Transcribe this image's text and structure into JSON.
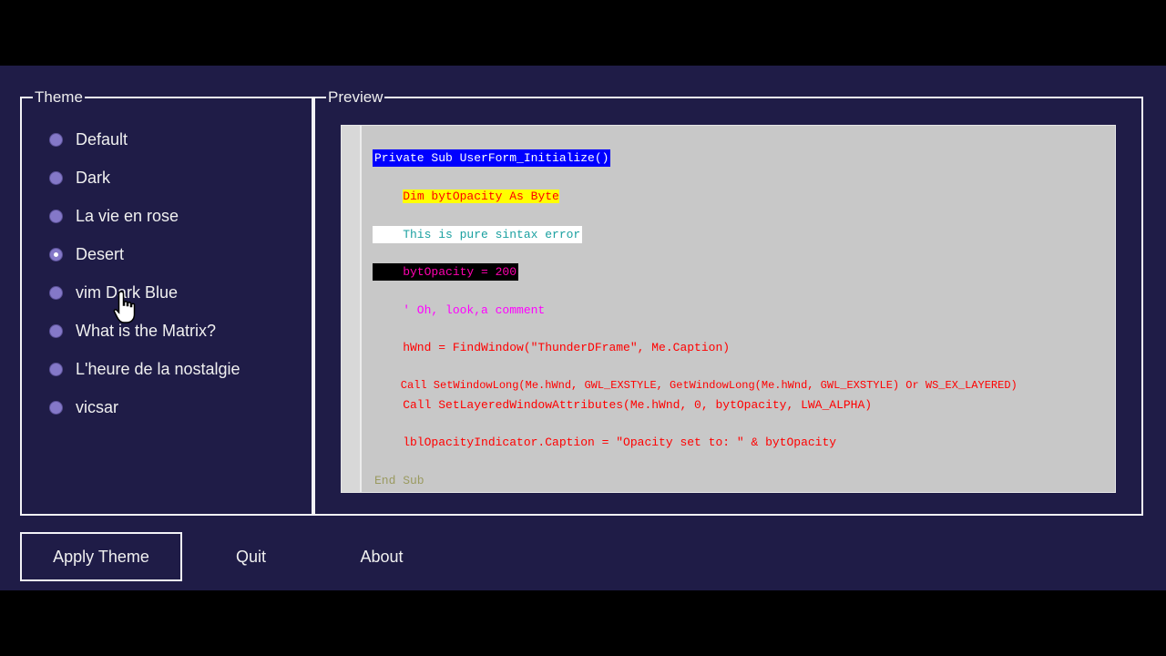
{
  "theme_group": {
    "legend": "Theme",
    "options": [
      {
        "label": "Default",
        "checked": false
      },
      {
        "label": "Dark",
        "checked": false
      },
      {
        "label": "La vie en rose",
        "checked": false
      },
      {
        "label": "Desert",
        "checked": true
      },
      {
        "label": "vim Dark Blue",
        "checked": false
      },
      {
        "label": "What is the Matrix?",
        "checked": false
      },
      {
        "label": "L'heure de la nostalgie",
        "checked": false
      },
      {
        "label": "vicsar",
        "checked": false
      }
    ]
  },
  "preview_group": {
    "legend": "Preview",
    "code_lines": [
      {
        "text": "Private Sub UserForm_Initialize()",
        "color": "#ffffff",
        "bg": "#0000ff"
      },
      {
        "text": "    Dim bytOpacity As Byte",
        "color": "#ff0000",
        "bg": "#ffff00"
      },
      {
        "text": "    This is pure sintax error",
        "color": "#1aa0a0",
        "bg": "#ffffff"
      },
      {
        "text": "    bytOpacity = 200",
        "color": "#ff00b0",
        "bg": "#000000"
      },
      {
        "text": "    ' Oh, look,a comment",
        "color": "#ff00ff",
        "bg": ""
      },
      {
        "text": "    hWnd = FindWindow(\"ThunderDFrame\", Me.Caption)",
        "color": "#ff0000",
        "bg": ""
      },
      {
        "text": "    Call SetWindowLong(Me.hWnd, GWL_EXSTYLE, GetWindowLong(Me.hWnd, GWL_EXSTYLE) Or WS_EX_LAYERED)",
        "color": "#ff0000",
        "bg": ""
      },
      {
        "text": "    Call SetLayeredWindowAttributes(Me.hWnd, 0, bytOpacity, LWA_ALPHA)",
        "color": "#ff0000",
        "bg": ""
      },
      {
        "text": "    lblOpacityIndicator.Caption = \"Opacity set to: \" & bytOpacity",
        "color": "#ff0000",
        "bg": ""
      },
      {
        "text": "End Sub",
        "color": "#9a9a60",
        "bg": ""
      }
    ]
  },
  "buttons": {
    "apply": "Apply Theme",
    "quit": "Quit",
    "about": "About"
  },
  "colors": {
    "window_bg": "#1f1c47",
    "border": "#f2f2f6",
    "radio": "#8478c8",
    "editor_bg": "#c8c8c8"
  },
  "icons": {
    "cursor": "hand-pointer-icon"
  }
}
